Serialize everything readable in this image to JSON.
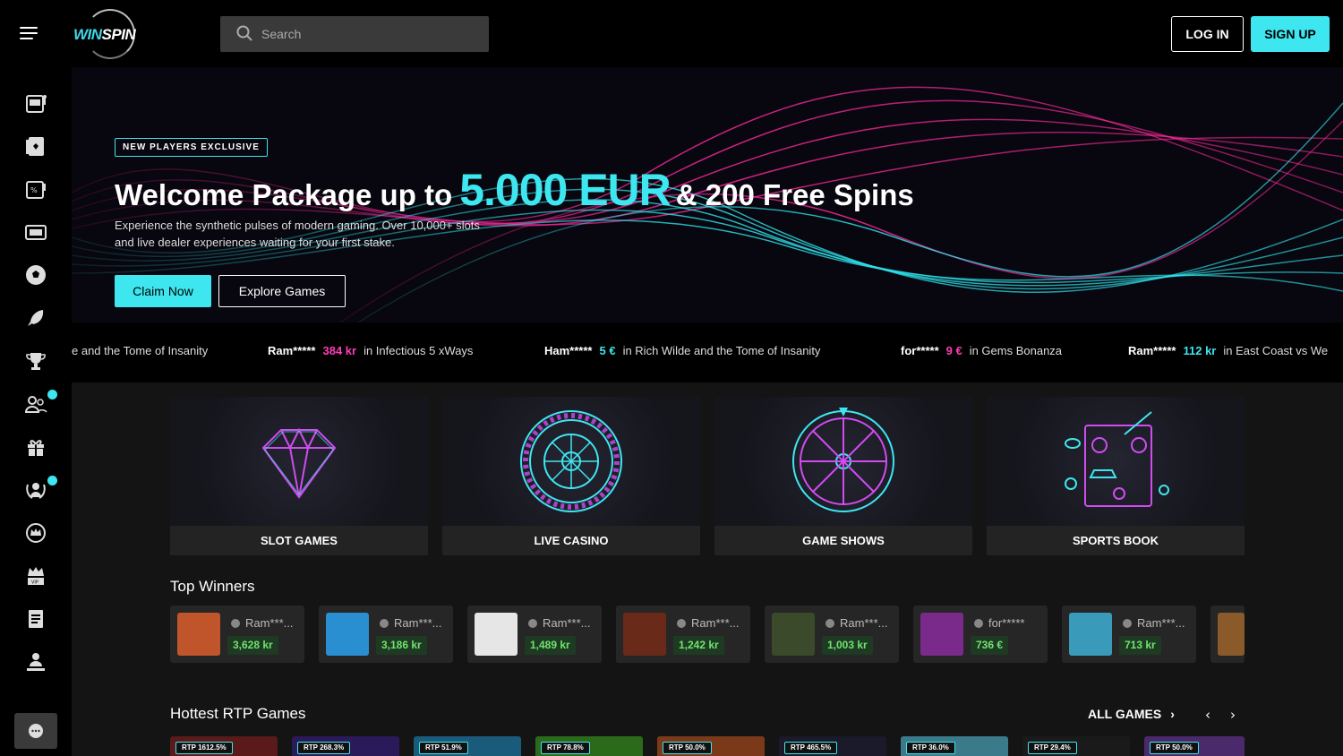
{
  "brand": {
    "logo_part1": "WIN",
    "logo_part2": "SPIN"
  },
  "search": {
    "placeholder": "Search"
  },
  "auth": {
    "login": "LOG IN",
    "signup": "SIGN UP"
  },
  "hero": {
    "badge": "NEW PLAYERS EXCLUSIVE",
    "title_before": "Welcome Package up to",
    "title_amount": "5.000 EUR",
    "title_after": "& 200 Free Spins",
    "description": "Experience the synthetic pulses of modern gaming. Over 10,000+ slots and live dealer experiences waiting for your first stake.",
    "claim_button": "Claim Now",
    "explore_button": "Explore Games"
  },
  "ticker": [
    {
      "user": "",
      "amount": "",
      "game": "e and the Tome of Insanity",
      "color": "#ff3db8"
    },
    {
      "user": "Ram*****",
      "amount": "384 kr",
      "game": "in Infectious 5 xWays",
      "color": "#ff3db8"
    },
    {
      "user": "Ham*****",
      "amount": "5 €",
      "game": "in Rich Wilde and the Tome of Insanity",
      "color": "#3ee6ef"
    },
    {
      "user": "for*****",
      "amount": "9 €",
      "game": "in Gems Bonanza",
      "color": "#ff3db8"
    },
    {
      "user": "Ram*****",
      "amount": "112 kr",
      "game": "in East Coast vs We",
      "color": "#3ee6ef"
    }
  ],
  "categories": [
    {
      "label": "SLOT GAMES",
      "icon": "diamond-icon"
    },
    {
      "label": "LIVE CASINO",
      "icon": "roulette-icon"
    },
    {
      "label": "GAME SHOWS",
      "icon": "wheel-icon"
    },
    {
      "label": "SPORTS BOOK",
      "icon": "sportsbook-icon"
    }
  ],
  "top_winners": {
    "title": "Top Winners",
    "items": [
      {
        "user": "Ram***...",
        "amount": "3,628 kr",
        "thumb": "#c0542a"
      },
      {
        "user": "Ram***...",
        "amount": "3,186 kr",
        "thumb": "#2a8fd0"
      },
      {
        "user": "Ram***...",
        "amount": "1,489 kr",
        "thumb": "#e6e6e6"
      },
      {
        "user": "Ram***...",
        "amount": "1,242 kr",
        "thumb": "#6a2a1a"
      },
      {
        "user": "Ram***...",
        "amount": "1,003 kr",
        "thumb": "#3a4a2a"
      },
      {
        "user": "for*****",
        "amount": "736 €",
        "thumb": "#7a2a8a"
      },
      {
        "user": "Ram***...",
        "amount": "713 kr",
        "thumb": "#3a9aba"
      }
    ]
  },
  "hottest": {
    "title": "Hottest RTP Games",
    "all_games": "ALL GAMES",
    "items": [
      {
        "rtp": "RTP 1612.5%",
        "bg": "#5a1a1a"
      },
      {
        "rtp": "RTP 268.3%",
        "bg": "#2a1a5a"
      },
      {
        "rtp": "RTP 51.9%",
        "bg": "#1a5a7a"
      },
      {
        "rtp": "RTP 78.8%",
        "bg": "#2a6a1a"
      },
      {
        "rtp": "RTP 50.0%",
        "bg": "#7a3a1a"
      },
      {
        "rtp": "RTP 465.5%",
        "bg": "#1a1a2a"
      },
      {
        "rtp": "RTP 36.0%",
        "bg": "#3a7a8a"
      },
      {
        "rtp": "RTP 29.4%",
        "bg": "#1a1a1a"
      },
      {
        "rtp": "RTP 50.0%",
        "bg": "#4a2a6a"
      }
    ]
  },
  "colors": {
    "accent": "#3ee6ef",
    "pink": "#ff3db8",
    "win_green": "#6fe36f"
  }
}
